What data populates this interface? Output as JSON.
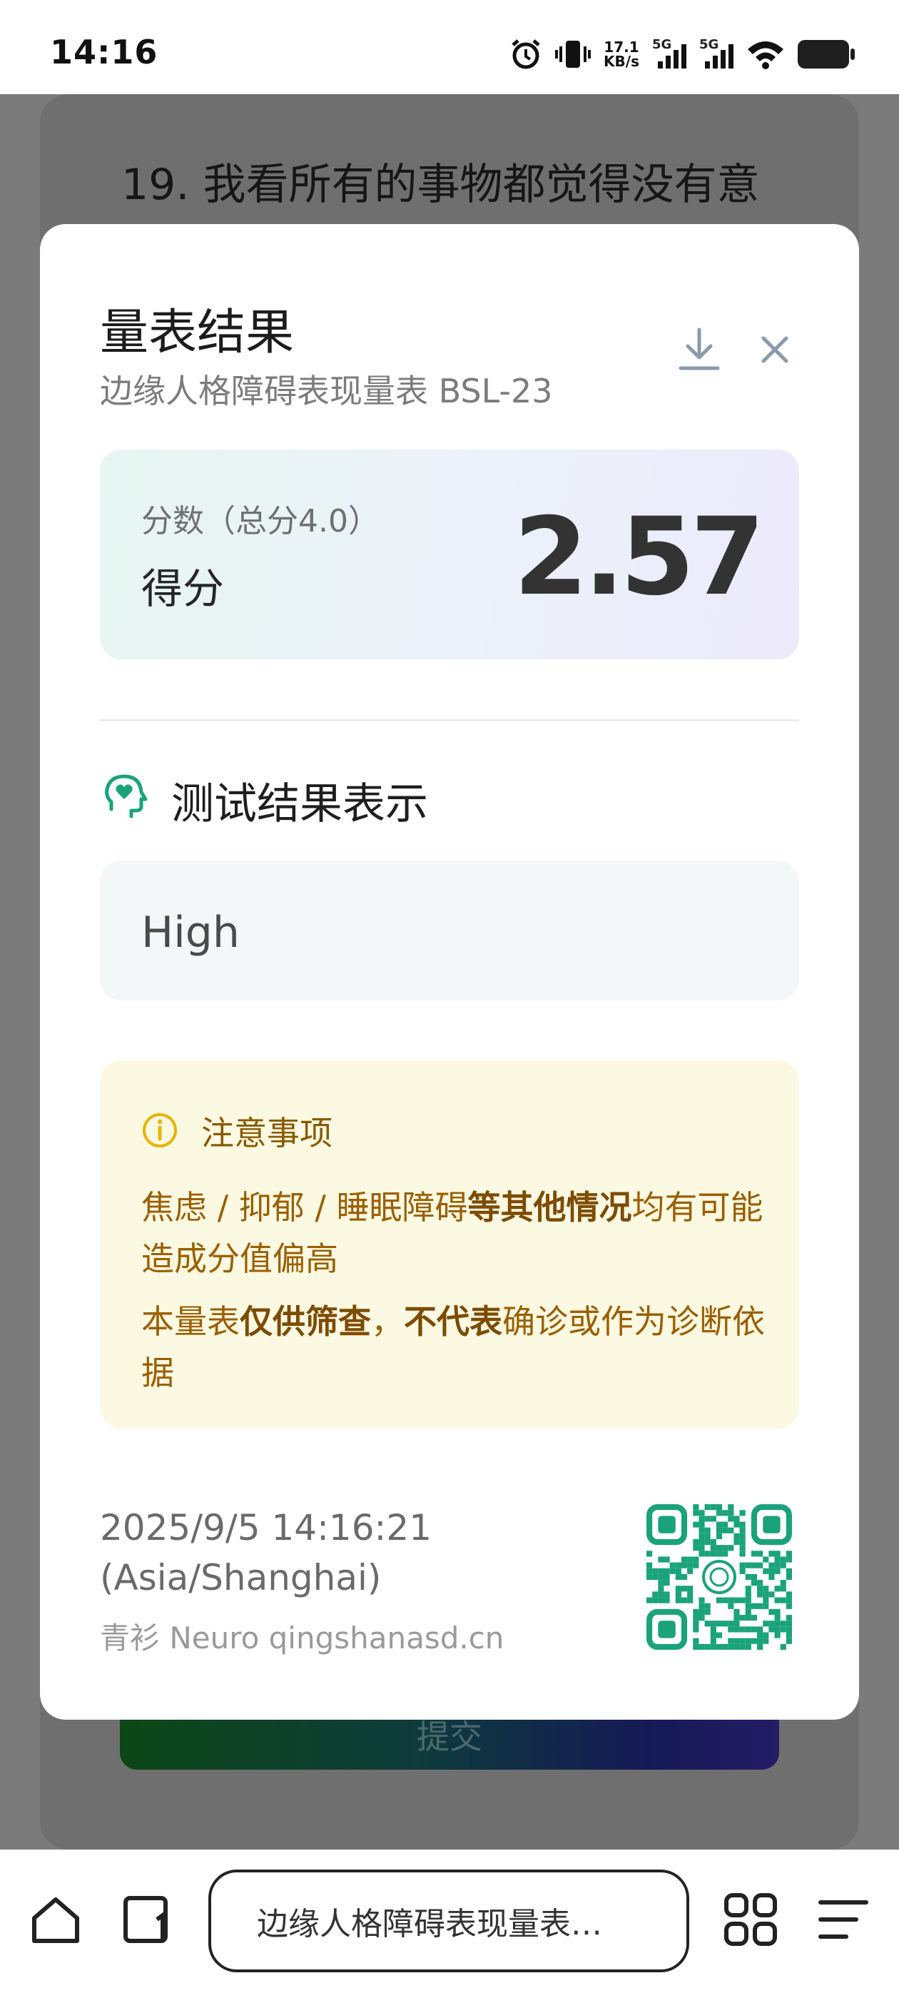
{
  "status_bar": {
    "time": "14:16",
    "net_speed_value": "17.1",
    "net_speed_unit": "KB/s",
    "sim1_label": "5G",
    "sim2_label": "5G",
    "icons": [
      "alarm-icon",
      "vibrate-icon",
      "signal-icon",
      "signal-icon",
      "wifi-icon",
      "battery-icon"
    ]
  },
  "background": {
    "question": "19. 我看所有的事物都觉得没有意",
    "submit_label": "提交"
  },
  "modal": {
    "title": "量表结果",
    "subtitle": "边缘人格障碍表现量表 BSL-23",
    "score": {
      "caption": "分数（总分4.0）",
      "label": "得分",
      "value": "2.57"
    },
    "result": {
      "title": "测试结果表示",
      "value": "High"
    },
    "notice": {
      "title": "注意事项",
      "line1_a": "焦虑 / 抑郁 / 睡眠障碍",
      "line1_b": "等其他情况",
      "line1_c": "均有可能造成分值偏高",
      "line2_a": "本量表",
      "line2_b": "仅供筛查",
      "line2_c": "，",
      "line2_d": "不代表",
      "line2_e": "确诊或作为诊断依据"
    },
    "timestamp": "2025/9/5 14:16:21",
    "timezone": "(Asia/Shanghai)",
    "brand": "青衫 Neuro qingshanasd.cn"
  },
  "bottom_bar": {
    "address": "边缘人格障碍表现量表…"
  },
  "colors": {
    "accent_green": "#1aa37a",
    "notice_text": "#9b5f00",
    "notice_bg": "#fcf9e2"
  }
}
